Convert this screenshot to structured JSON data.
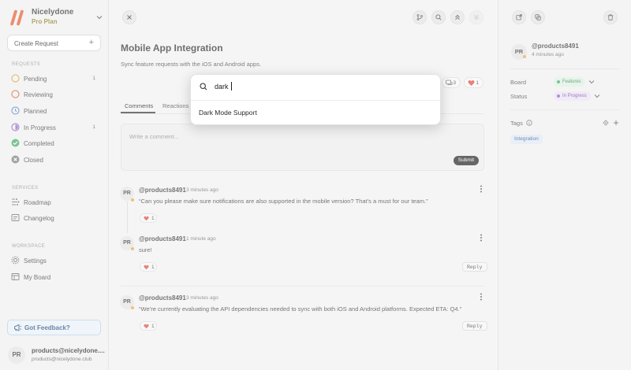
{
  "brand": {
    "name": "Nicelydone",
    "plan": "Pro Plan",
    "colors": {
      "logo": "#e2582a",
      "plan_text": "#8a7a1a"
    }
  },
  "create_button": {
    "label": "Create Request"
  },
  "sections": {
    "requests": "REQUESTS",
    "services": "SERVICES",
    "workspace": "WORKSPACE"
  },
  "requests_nav": [
    {
      "label": "Pending",
      "count": "1",
      "icon": "pending-circle-icon",
      "color": "#e0a23a"
    },
    {
      "label": "Reviewing",
      "count": "",
      "icon": "reviewing-circle-icon",
      "color": "#d86a3e"
    },
    {
      "label": "Planned",
      "count": "",
      "icon": "clock-icon",
      "color": "#5d84c4"
    },
    {
      "label": "In Progress",
      "count": "1",
      "icon": "in-progress-icon",
      "color": "#8b5cc4"
    },
    {
      "label": "Completed",
      "count": "",
      "icon": "check-circle-icon",
      "color": "#3fa864"
    },
    {
      "label": "Closed",
      "count": "",
      "icon": "x-circle-icon",
      "color": "#777777"
    }
  ],
  "services_nav": [
    {
      "label": "Roadmap",
      "icon": "roadmap-icon"
    },
    {
      "label": "Changelog",
      "icon": "changelog-icon"
    }
  ],
  "workspace_nav": [
    {
      "label": "Settings",
      "icon": "gear-icon"
    },
    {
      "label": "My Board",
      "icon": "board-icon"
    }
  ],
  "feedback": {
    "label": "Got Feedback?"
  },
  "user": {
    "initials": "PR",
    "name": "products@nicelydone....",
    "email": "products@nicelydone.club"
  },
  "request": {
    "title": "Mobile App Integration",
    "description": "Sync feature requests with the iOS and Android apps.",
    "comment_count": "3",
    "reaction_count": "1"
  },
  "tabs": [
    {
      "label": "Comments"
    },
    {
      "label": "Reactions"
    }
  ],
  "comment_box": {
    "placeholder": "Write a comment...",
    "submit": "Submit"
  },
  "comments": [
    {
      "initials": "PR",
      "user": "@products8491",
      "time": "3 minutes ago",
      "text": "“Can you please make sure notifications are also supported in the mobile version? That’s a must for our team.”",
      "reactions": "1",
      "reply": ""
    },
    {
      "initials": "PR",
      "user": "@products8491",
      "time": "1 minute ago",
      "text": "sure!",
      "reactions": "1",
      "reply": "Reply"
    },
    {
      "initials": "PR",
      "user": "@products8491",
      "time": "3 minutes ago",
      "text": "“We’re currently evaluating the API dependencies needed to sync with both iOS and Android platforms. Expected ETA: Q4.”",
      "reactions": "1",
      "reply": "Reply"
    }
  ],
  "details": {
    "initials": "PR",
    "user": "@products8491",
    "time": "4 minutes ago",
    "board_label": "Board",
    "board_value": "Features",
    "status_label": "Status",
    "status_value": "In Progress",
    "tags_label": "Tags",
    "tag": "Integration",
    "colors": {
      "board_badge_bg": "#dcefe1",
      "board_badge_text": "#2c7a45",
      "status_badge_bg": "#ebe0f4",
      "status_badge_text": "#6a3f96"
    }
  },
  "search": {
    "query": "dark",
    "result": "Dark Mode Support"
  }
}
